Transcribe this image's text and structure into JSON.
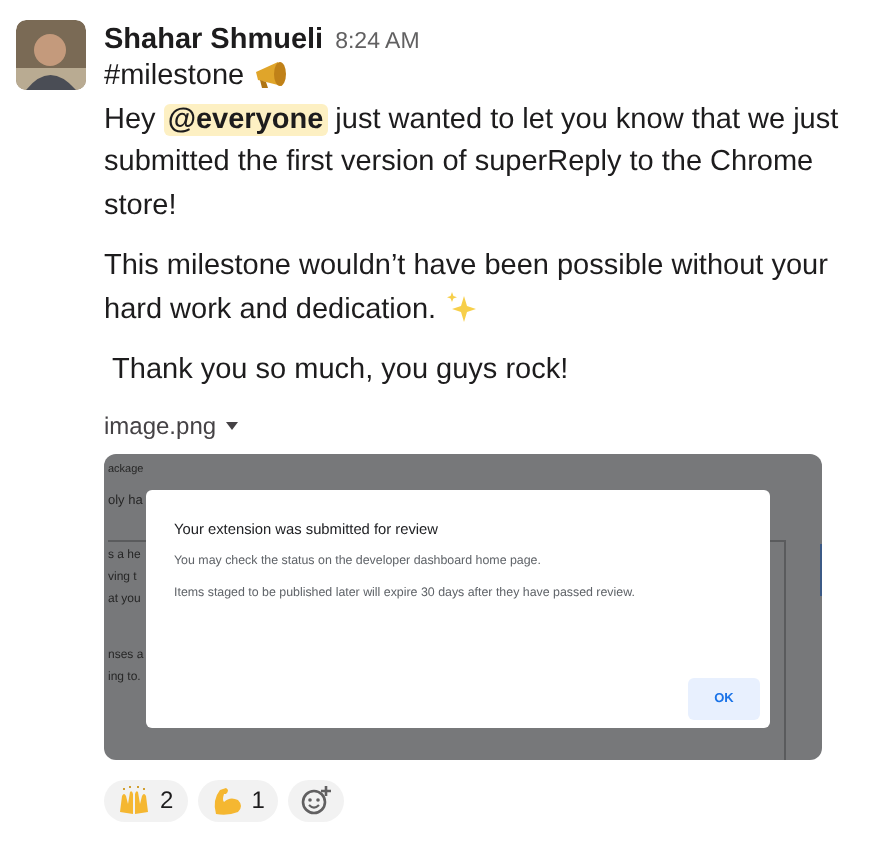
{
  "message": {
    "author": "Shahar Shmueli",
    "time": "8:24 AM",
    "paragraphs": [
      {
        "kind": "channel",
        "text": "#milestone"
      },
      {
        "kind": "mention",
        "before": "Hey ",
        "mention": "@everyone",
        "after": " just wanted to let you know that we just submitted the first version of superReply to the Chrome store!"
      },
      {
        "kind": "sparkle",
        "text": "This milestone wouldn’t have been possible without your hard work and dedication."
      },
      {
        "kind": "plain",
        "text": " Thank you so much, you guys rock!"
      }
    ],
    "attachment": {
      "file_name": "image.png",
      "background_fragments": [
        {
          "kind": "small",
          "text": "ackage"
        },
        {
          "kind": "large",
          "text": "oly ha"
        },
        {
          "kind": "panel",
          "text": "s a he"
        },
        {
          "kind": "panel",
          "text": "ving t"
        },
        {
          "kind": "panel",
          "text": "at you"
        },
        {
          "kind": "panel-gap",
          "text": "nses a"
        },
        {
          "kind": "panel",
          "text": "ing to."
        }
      ],
      "dialog": {
        "title": "Your extension was submitted for review",
        "lines": [
          "You may check the status on the developer dashboard home page.",
          "Items staged to be published later will expire 30 days after they have passed review."
        ],
        "button": "OK"
      }
    },
    "reactions": [
      {
        "kind": "raised-hands",
        "count": "2"
      },
      {
        "kind": "flexed-biceps",
        "count": "1"
      }
    ]
  }
}
